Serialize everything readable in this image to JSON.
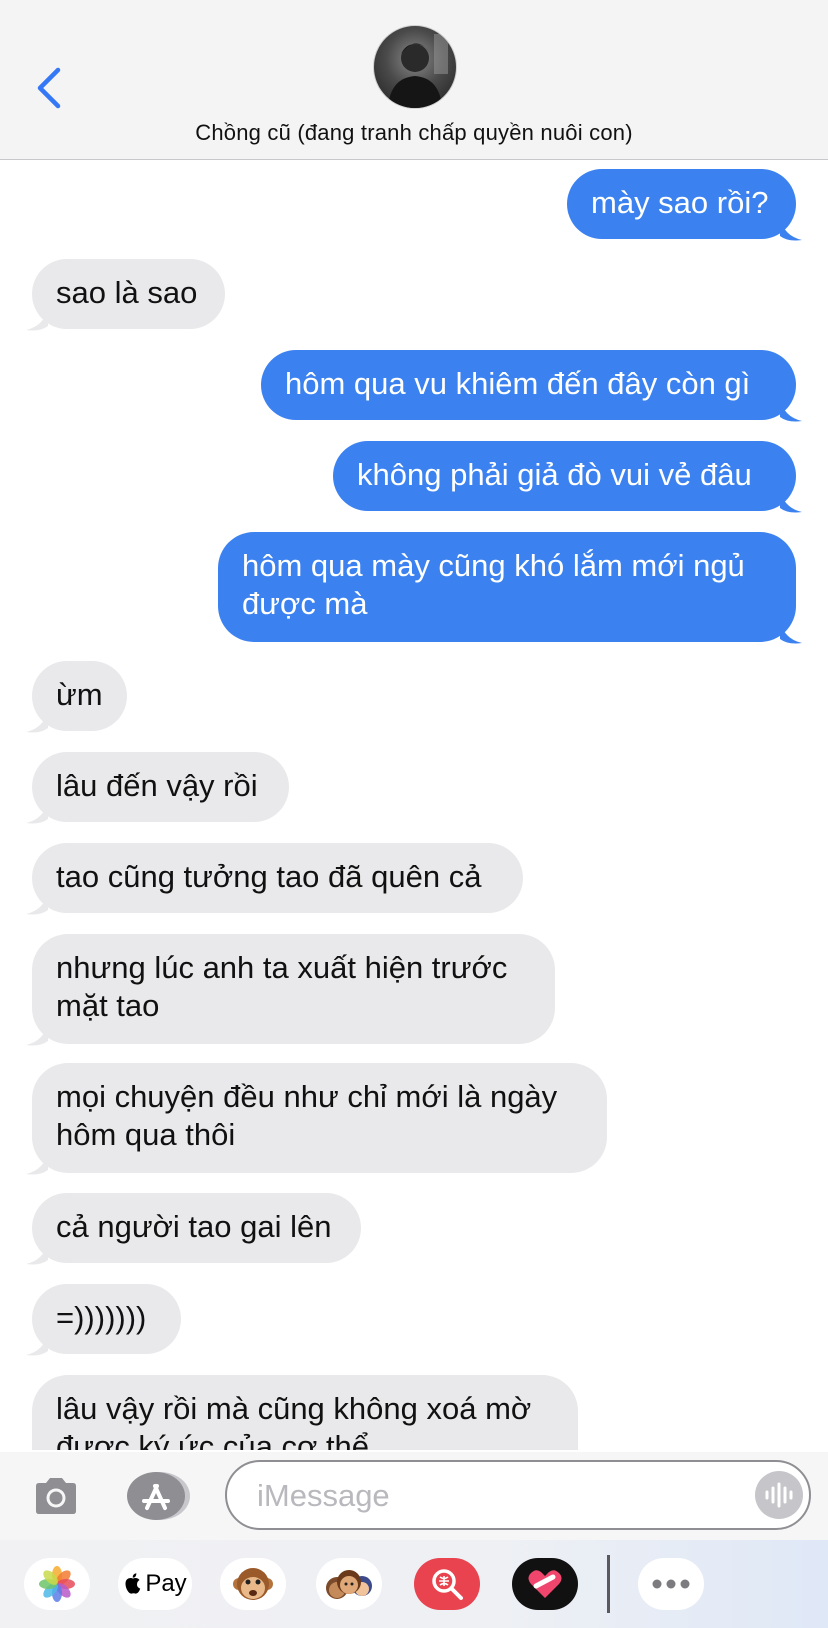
{
  "header": {
    "contact_name": "Chồng cũ (đang tranh chấp quyền nuôi con)"
  },
  "messages": [
    {
      "dir": "out",
      "text": "mày sao rồi?"
    },
    {
      "dir": "in",
      "text": "sao là sao"
    },
    {
      "dir": "out",
      "text": "hôm qua vu khiêm đến đây còn gì"
    },
    {
      "dir": "out",
      "text": "không phải giả đò vui vẻ đâu"
    },
    {
      "dir": "out",
      "lines": [
        "hôm qua mày cũng khó lắm mới ngủ",
        "được mà"
      ]
    },
    {
      "dir": "in",
      "text": "ừm"
    },
    {
      "dir": "in",
      "text": "lâu đến vậy rồi"
    },
    {
      "dir": "in",
      "text": "tao cũng tưởng tao đã quên cả"
    },
    {
      "dir": "in",
      "lines": [
        "nhưng lúc anh ta xuất hiện trước",
        "mặt tao"
      ]
    },
    {
      "dir": "in",
      "lines": [
        "mọi chuyện đều như chỉ mới là ngày",
        "hôm qua thôi"
      ]
    },
    {
      "dir": "in",
      "text": "cả người tao gai lên"
    },
    {
      "dir": "in",
      "text": "=)))))))"
    },
    {
      "dir": "in",
      "lines": [
        "lâu vậy rồi mà cũng không xoá mờ",
        "được ký ức của cơ thể"
      ]
    }
  ],
  "input": {
    "placeholder": "iMessage"
  },
  "apps": {
    "apple_pay_label": "Pay",
    "items": [
      "photos-icon",
      "apple-pay-icon",
      "monkey-memoji-icon",
      "memoji-stickers-icon",
      "image-search-icon",
      "heart-app-icon",
      "more-icon"
    ]
  },
  "colors": {
    "outgoing_bubble": "#3b82f0",
    "incoming_bubble": "#e9e9eb",
    "accent": "#3478f6"
  }
}
